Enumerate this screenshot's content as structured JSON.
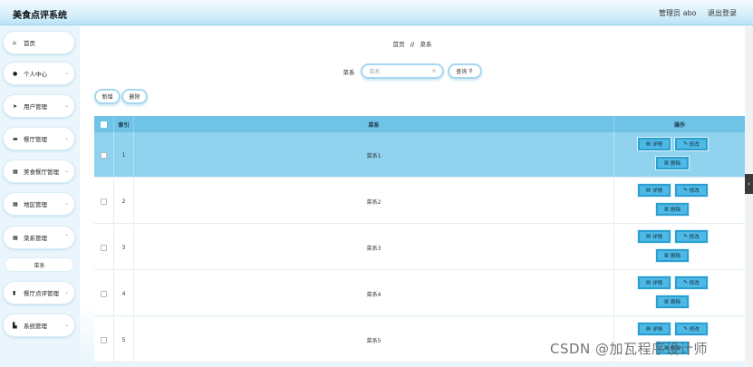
{
  "app": {
    "title": "美食点评系统"
  },
  "header": {
    "admin_label": "管理员 abo",
    "logout_label": "退出登录"
  },
  "sidebar": {
    "items": [
      {
        "label": "首页",
        "icon": "home-icon"
      },
      {
        "label": "个人中心",
        "icon": "user-icon"
      },
      {
        "label": "用户管理",
        "icon": "send-icon"
      },
      {
        "label": "餐厅管理",
        "icon": "card-icon"
      },
      {
        "label": "美食餐厅管理",
        "icon": "grid-icon"
      },
      {
        "label": "地区管理",
        "icon": "grid-icon"
      },
      {
        "label": "菜系管理",
        "icon": "grid-icon"
      },
      {
        "label": "餐厅点评管理",
        "icon": "book-icon"
      },
      {
        "label": "系统管理",
        "icon": "folder-icon"
      }
    ],
    "sub_items": [
      {
        "label": "菜系"
      }
    ]
  },
  "breadcrumb": {
    "home": "首页",
    "separator": "//",
    "current": "菜系"
  },
  "search": {
    "label": "菜系",
    "placeholder": "菜系",
    "query_label": "查询"
  },
  "toolbar": {
    "add_label": "新增",
    "delete_label": "删除"
  },
  "table": {
    "headers": {
      "index": "索引",
      "name": "菜系",
      "actions": "操作"
    },
    "rows": [
      {
        "index": "1",
        "name": "菜系1"
      },
      {
        "index": "2",
        "name": "菜系2"
      },
      {
        "index": "3",
        "name": "菜系3"
      },
      {
        "index": "4",
        "name": "菜系4"
      },
      {
        "index": "5",
        "name": "菜系5"
      }
    ],
    "actions": {
      "detail": "详情",
      "edit": "修改",
      "delete": "删除"
    }
  },
  "watermark": "CSDN @加瓦程序设计师",
  "colors": {
    "header_bg": "#6ec3e6",
    "selected_row": "#8fd3ef",
    "button_bg": "#4fb9e6"
  }
}
